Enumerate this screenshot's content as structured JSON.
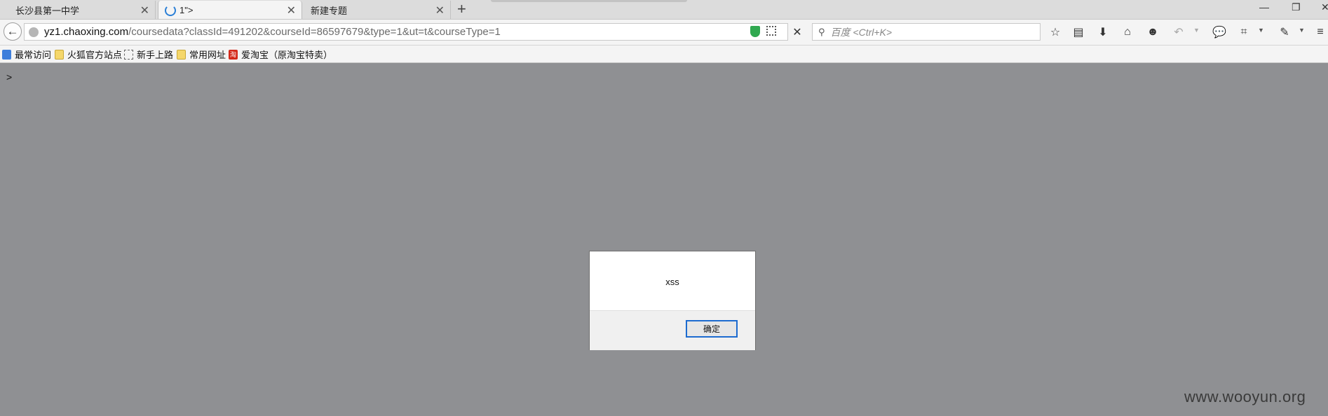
{
  "tabs": [
    {
      "label": "长沙县第一中学",
      "close": "✕"
    },
    {
      "label": "1\">",
      "close": "✕"
    },
    {
      "label": "新建专题",
      "close": "✕"
    }
  ],
  "new_tab": "+",
  "window_controls": {
    "minimize": "—",
    "restore": "❐",
    "close": "✕"
  },
  "nav": {
    "back": "←",
    "url_host": "yz1.chaoxing.com",
    "url_path": "/coursedata?classId=491202&courseId=86597679&type=1&ut=t&courseType=1",
    "stop": "✕",
    "search_placeholder": "百度 <Ctrl+K>",
    "search_icon": "⚲"
  },
  "toolbar_icons": [
    {
      "name": "bookmark-star-icon",
      "glyph": "☆"
    },
    {
      "name": "reading-list-icon",
      "glyph": "▤"
    },
    {
      "name": "download-icon",
      "glyph": "⬇"
    },
    {
      "name": "home-icon",
      "glyph": "⌂"
    },
    {
      "name": "smiley-icon",
      "glyph": "☻"
    },
    {
      "name": "undo-icon",
      "glyph": "↶"
    },
    {
      "name": "chat-icon",
      "glyph": "💬"
    },
    {
      "name": "crop-icon",
      "glyph": "⌗"
    },
    {
      "name": "extension-icon",
      "glyph": "✎"
    },
    {
      "name": "menu-icon",
      "glyph": "≡"
    }
  ],
  "bookmarks": [
    {
      "label": "最常访问",
      "icon": "fav-blue"
    },
    {
      "label": "火狐官方站点",
      "icon": "folder"
    },
    {
      "label": "新手上路",
      "icon": "dotted"
    },
    {
      "label": "常用网址",
      "icon": "folder"
    },
    {
      "label": "爱淘宝（原淘宝特卖）",
      "icon": "fav-red",
      "icon_text": "淘"
    }
  ],
  "page": {
    "text": ">"
  },
  "dialog": {
    "message": "xss",
    "ok_label": "确定"
  },
  "watermark": "www.wooyun.org"
}
